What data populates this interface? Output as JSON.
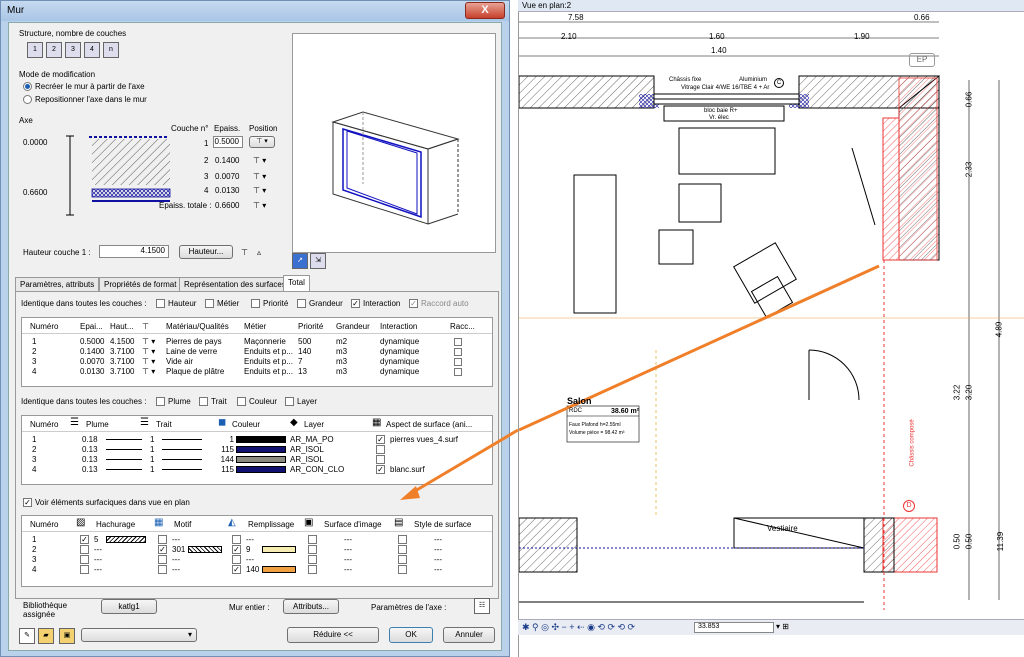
{
  "dialog": {
    "title": "Mur",
    "close": "X",
    "structure_label": "Structure, nombre de couches",
    "structure_buttons": [
      "1",
      "2",
      "3",
      "4",
      "n"
    ],
    "mode_label": "Mode de modification",
    "mode_options": [
      "Recréer le mur à partir de l'axe",
      "Repositionner l'axe dans le mur"
    ],
    "axe_label": "Axe",
    "axe_values": [
      "0.0000",
      "0.6600"
    ],
    "layers_header": {
      "couche": "Couche n°",
      "epaiss": "Epaiss.",
      "position": "Position"
    },
    "layers": [
      {
        "n": "1",
        "e": "0.5000"
      },
      {
        "n": "2",
        "e": "0.1400"
      },
      {
        "n": "3",
        "e": "0.0070"
      },
      {
        "n": "4",
        "e": "0.0130"
      }
    ],
    "total_label": "Epaiss. totale :",
    "total_value": "0.6600",
    "hauteur_label": "Hauteur couche 1 :",
    "hauteur_value": "4.1500",
    "hauteur_button": "Hauteur...",
    "tabs": [
      "Paramètres, attributs",
      "Propriétés de format",
      "Représentation des surfaces",
      "Total"
    ],
    "ident1_label": "Identique dans toutes les couches :",
    "ident1_options": [
      {
        "label": "Hauteur",
        "checked": false
      },
      {
        "label": "Métier",
        "checked": false
      },
      {
        "label": "Priorité",
        "checked": false
      },
      {
        "label": "Grandeur",
        "checked": false
      },
      {
        "label": "Interaction",
        "checked": true
      },
      {
        "label": "Raccord auto",
        "checked": true
      }
    ],
    "table1_headers": [
      "Numéro",
      "Epai...",
      "Haut...",
      "",
      "Matériau/Qualités",
      "Métier",
      "Priorité",
      "Grandeur",
      "Interaction",
      "Racc..."
    ],
    "table1_rows": [
      [
        "1",
        "0.5000",
        "4.1500",
        "Pierres de pays",
        "Maçonnerie",
        "500",
        "m2",
        "dynamique"
      ],
      [
        "2",
        "0.1400",
        "3.7100",
        "Laine de verre",
        "Enduits et p...",
        "140",
        "m3",
        "dynamique"
      ],
      [
        "3",
        "0.0070",
        "3.7100",
        "Vide air",
        "Enduits et p...",
        "7",
        "m3",
        "dynamique"
      ],
      [
        "4",
        "0.0130",
        "3.7100",
        "Plaque de plâtre",
        "Enduits et p...",
        "13",
        "m3",
        "dynamique"
      ]
    ],
    "ident2_label": "Identique dans toutes les couches :",
    "ident2_options": [
      "Plume",
      "Trait",
      "Couleur",
      "Layer"
    ],
    "table2_headers": [
      "Numéro",
      "Plume",
      "Trait",
      "Couleur",
      "Layer",
      "Aspect de surface (ani..."
    ],
    "table2_rows": [
      {
        "n": "1",
        "plume": "0.18",
        "trait": "1",
        "couleur": "1",
        "color": "#000000",
        "layer": "AR_MA_PO",
        "aspect": "pierres vues_4.surf"
      },
      {
        "n": "2",
        "plume": "0.13",
        "trait": "1",
        "couleur": "115",
        "color": "#101070",
        "layer": "AR_ISOL",
        "aspect": ""
      },
      {
        "n": "3",
        "plume": "0.13",
        "trait": "1",
        "couleur": "144",
        "color": "#8a8a80",
        "layer": "AR_ISOL",
        "aspect": ""
      },
      {
        "n": "4",
        "plume": "0.13",
        "trait": "1",
        "couleur": "115",
        "color": "#101070",
        "layer": "AR_CON_CLO",
        "aspect": "blanc.surf"
      }
    ],
    "voir_label": "Voir éléments surfaciques dans vue en plan",
    "table3_headers": [
      "Numéro",
      "Hachurage",
      "Motif",
      "Remplissage",
      "Surface d'image",
      "Style de surface"
    ],
    "table3_rows": [
      {
        "n": "1",
        "hach": "5",
        "motif": "---",
        "rempl": "---",
        "surf": "---",
        "style": "---"
      },
      {
        "n": "2",
        "hach": "---",
        "motif": "301",
        "rempl": "9",
        "surf": "---",
        "style": "---"
      },
      {
        "n": "3",
        "hach": "---",
        "motif": "---",
        "rempl": "---",
        "surf": "---",
        "style": "---"
      },
      {
        "n": "4",
        "hach": "---",
        "motif": "---",
        "rempl": "140",
        "surf": "---",
        "style": "---"
      }
    ],
    "biblio_label": "Bibliothèque assignée",
    "biblio_button": "katlg1",
    "mur_entier_label": "Mur entier :",
    "attributs_button": "Attributs...",
    "params_axe_label": "Paramètres de l'axe :",
    "reduire_button": "Réduire <<",
    "ok_button": "OK",
    "annuler_button": "Annuler"
  },
  "plan": {
    "title": "Vue en plan:2",
    "dims_top": [
      "7.58",
      "0.66"
    ],
    "dims_row2": [
      "2.10",
      "1.60",
      "1.90"
    ],
    "dims_row3": "1.40",
    "ep_label": "EP",
    "chassis_label": "Châssis fixe",
    "chassis_material": "Aluminium",
    "chassis_glazing": "Vitrage Clair 4/WE 16/TBE 4 + Ar",
    "chassis_code": "C",
    "bloc_label": "bloc baie R+",
    "bloc_sub": "Vr. élec",
    "salon_label": "Salon",
    "salon_rdc": "RDC",
    "salon_area": "38.60 m²",
    "salon_ceiling": "Faux Plafond h=2.55ml",
    "salon_volume": "Volume pièce =   98.42 m³",
    "vestiaire_label": "Vestiaire",
    "right_dims": [
      "0.66",
      "2.33",
      "4.89",
      "3.22",
      "3.20",
      "0.50",
      "0.50",
      "11.39"
    ],
    "red_code": "D",
    "red_text": "Châssis composé",
    "zoom_value": "33.853"
  },
  "colors": {
    "accent_arrow": "#f07f2a",
    "blue_layer": "#101070",
    "red_hatch": "#e33333"
  }
}
